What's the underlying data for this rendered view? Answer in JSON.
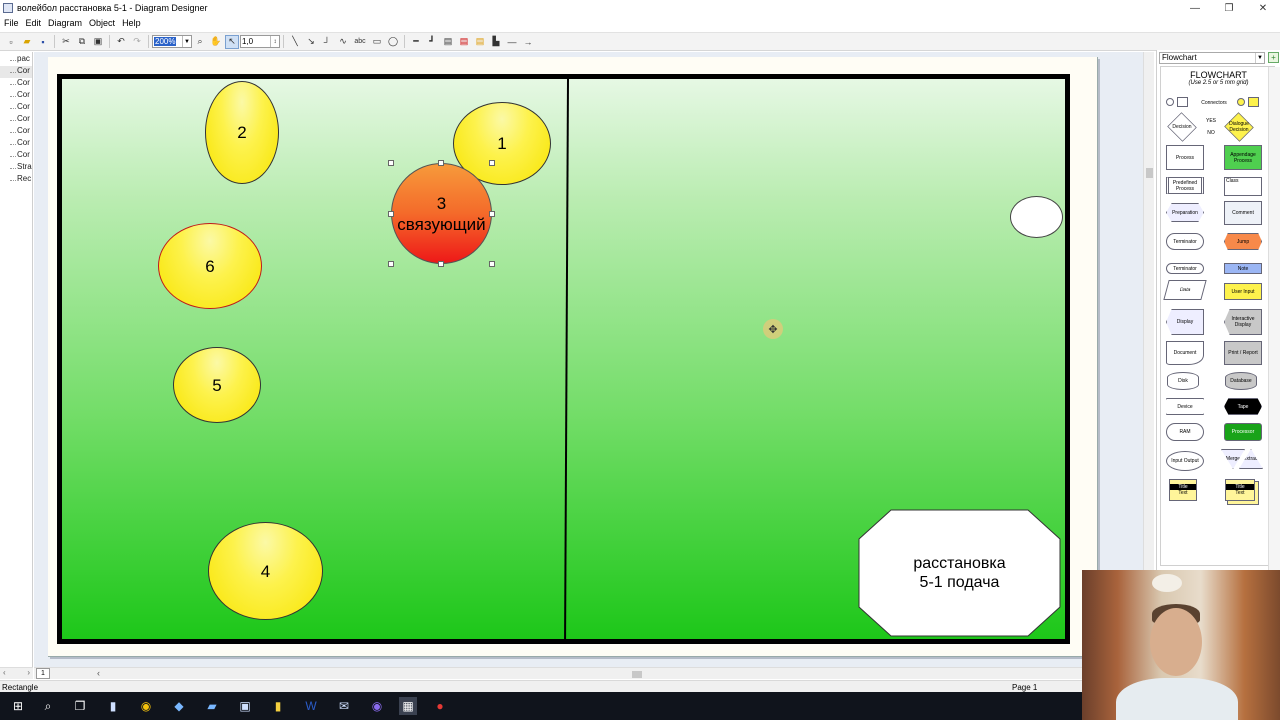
{
  "window": {
    "title": "волейбол  расстановка 5-1 - Diagram Designer",
    "controls": [
      "—",
      "❐",
      "✕"
    ]
  },
  "menu": [
    "File",
    "Edit",
    "Diagram",
    "Object",
    "Help"
  ],
  "toolbar": {
    "zoom": "200%",
    "line_width": "1,0",
    "text_tool": "abc"
  },
  "tree": {
    "items": [
      "рас",
      "Cor",
      "Cor",
      "Cor",
      "Cor",
      "Cor",
      "Cor",
      "Cor",
      "Cor",
      "Stra",
      "Rec"
    ],
    "selected_index": 1
  },
  "diagram": {
    "players": [
      {
        "label": "2"
      },
      {
        "label": "1"
      },
      {
        "label": "3",
        "sublabel": "связующий"
      },
      {
        "label": "6"
      },
      {
        "label": "5"
      },
      {
        "label": "4"
      }
    ],
    "note_lines": [
      "расстановка",
      "5-1 подача"
    ]
  },
  "page_tab": "1",
  "palette": {
    "selected": "Flowchart",
    "title": "FLOWCHART",
    "subtitle": "(Use 2.5 or 5 mm grid)",
    "labels": {
      "connectors": "Connectors",
      "yes": "YES",
      "no": "NO",
      "decision": "Decision",
      "dialogue_decision": "Dialogue Decision",
      "process": "Process",
      "appendage_process": "Appendage Process",
      "predefined_process": "Predefined Process",
      "class": "Class",
      "preparation": "Preparation",
      "comment": "Comment",
      "terminator": "Terminator",
      "jump": "Jump",
      "note": "Note",
      "data": "Data",
      "user_input": "User Input",
      "display": "Display",
      "interactive_display": "Interactive Display",
      "document": "Document",
      "print_report": "Print / Report",
      "disk": "Disk",
      "database": "Database",
      "device": "Device",
      "tape": "Tape",
      "ram": "RAM",
      "processor": "Processor",
      "input_output": "Input Output",
      "merge": "Merge",
      "extract": "Extract",
      "title": "Title",
      "text": "Text"
    }
  },
  "status": {
    "left": "Rectangle",
    "right": "Page 1"
  },
  "colors": {
    "player_fill": "#fdf24c",
    "setter_fill": "#ee1818",
    "court_top": "#e6f8e4",
    "court_bottom": "#1dc719"
  }
}
